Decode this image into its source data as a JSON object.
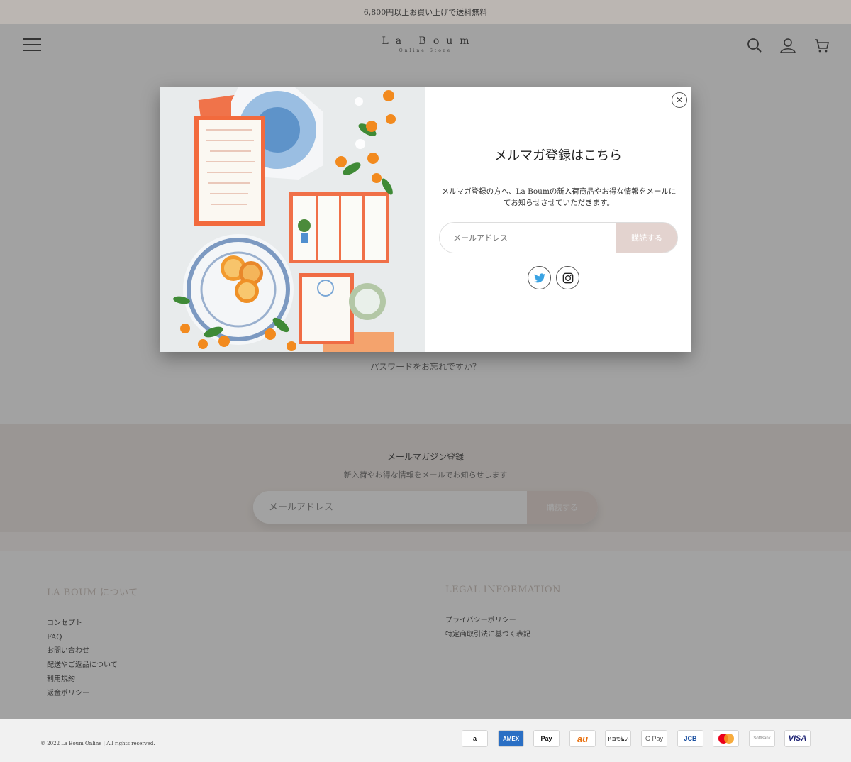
{
  "announcement": "6,800円以上お買い上げで送料無料",
  "header": {
    "logo_main": "La Boum",
    "logo_sub": "Online Store",
    "menu_icon": "hamburger-icon",
    "search_icon": "search-icon",
    "account_icon": "user-icon",
    "cart_icon": "cart-icon"
  },
  "main": {
    "forgot_password": "パスワードをお忘れですか？"
  },
  "newsletter": {
    "title": "メールマガジン登録",
    "subtitle": "新入荷やお得な情報をメールでお知らせします",
    "placeholder": "メールアドレス",
    "button": "購読する"
  },
  "footer": {
    "about_heading": "LA BOUM について",
    "about_links": [
      "コンセプト",
      "FAQ",
      "お問い合わせ",
      "配送やご返品について",
      "利用規約",
      "返金ポリシー"
    ],
    "legal_heading": "LEGAL INFORMATION",
    "legal_links": [
      "プライバシーポリシー",
      "特定商取引法に基づく表記"
    ],
    "copyright": "© 2022 La Boum Online | All rights reserved.",
    "payments": [
      {
        "name": "amazon-pay-icon",
        "label": "a"
      },
      {
        "name": "amex-icon",
        "label": "AMEX"
      },
      {
        "name": "apple-pay-icon",
        "label": "Pay"
      },
      {
        "name": "au-pay-icon",
        "label": "au"
      },
      {
        "name": "docomo-pay-icon",
        "label": "ドコモ払い"
      },
      {
        "name": "google-pay-icon",
        "label": "G Pay"
      },
      {
        "name": "jcb-icon",
        "label": "JCB"
      },
      {
        "name": "mastercard-icon",
        "label": ""
      },
      {
        "name": "softbank-icon",
        "label": "SoftBank"
      },
      {
        "name": "visa-icon",
        "label": "VISA"
      }
    ]
  },
  "modal": {
    "title": "メルマガ登録はこちら",
    "description": "メルマガ登録の方へ、La Boumの新入荷商品やお得な情報をメールにてお知らせさせていただきます。",
    "placeholder": "メールアドレス",
    "button": "購読する",
    "close_icon": "close-icon",
    "social": [
      "twitter-icon",
      "instagram-icon"
    ]
  },
  "colors": {
    "announce_bg": "#e2dbd6",
    "newsletter_bg": "#efe7e2",
    "button_blush": "#e3d3cf",
    "footer_heading": "#c9bcb5",
    "twitter_blue": "#3aa3e3"
  }
}
